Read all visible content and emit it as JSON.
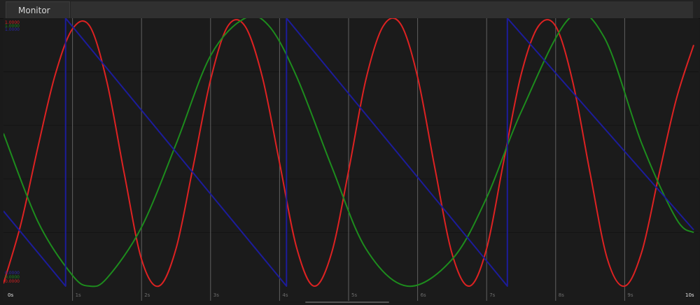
{
  "window": {
    "tab_label": "Monitor"
  },
  "colors": {
    "background": "#1b1b1b",
    "grid_minor": "#141414",
    "grid_major": "#606060",
    "red": "#dd2222",
    "green": "#1d8c1d",
    "blue": "#1c1c9a"
  },
  "chart_data": {
    "type": "line",
    "title": "",
    "xlabel": "",
    "ylabel": "",
    "xlim": [
      0,
      10
    ],
    "ylim": [
      0,
      1
    ],
    "grid": true,
    "x_ticks": [
      "0s",
      "1s",
      "2s",
      "3s",
      "4s",
      "5s",
      "6s",
      "7s",
      "8s",
      "9s",
      "10s"
    ],
    "legend": {
      "top": [
        {
          "text": "1.0000",
          "color": "#dd2222"
        },
        {
          "text": "1.0000",
          "color": "#1d8c1d"
        },
        {
          "text": "1.0000",
          "color": "#2a2ab0"
        }
      ],
      "bottom": [
        {
          "text": "0.0000",
          "color": "#2a2ab0"
        },
        {
          "text": "0.0000",
          "color": "#1d8c1d"
        },
        {
          "text": "0.0000",
          "color": "#dd2222"
        }
      ]
    },
    "series": [
      {
        "color": "#dd2222",
        "x": [
          0,
          0.25,
          0.5,
          0.75,
          1.0,
          1.25,
          1.5,
          1.75,
          2.0,
          2.25,
          2.5,
          2.75,
          3.0,
          3.25,
          3.5,
          3.75,
          4.0,
          4.25,
          4.5,
          4.75,
          5.0,
          5.25,
          5.5,
          5.75,
          6.0,
          6.25,
          6.5,
          6.75,
          7.0,
          7.25,
          7.5,
          7.75,
          8.0,
          8.25,
          8.5,
          8.75,
          9.0,
          9.25,
          9.5,
          9.75,
          10.0
        ],
        "y": [
          0.01,
          0.23,
          0.52,
          0.79,
          0.96,
          0.97,
          0.76,
          0.42,
          0.1,
          0.0,
          0.14,
          0.45,
          0.77,
          0.97,
          0.97,
          0.78,
          0.46,
          0.14,
          0.0,
          0.12,
          0.43,
          0.77,
          0.97,
          0.98,
          0.78,
          0.44,
          0.12,
          0.0,
          0.14,
          0.47,
          0.79,
          0.97,
          0.97,
          0.76,
          0.42,
          0.1,
          0.0,
          0.13,
          0.42,
          0.7,
          0.9
        ]
      },
      {
        "color": "#1d8c1d",
        "x": [
          0,
          0.5,
          1.0,
          1.25,
          1.5,
          2.0,
          2.5,
          3.0,
          3.5,
          3.85,
          4.25,
          4.75,
          5.25,
          5.85,
          6.5,
          7.0,
          7.5,
          8.2,
          8.7,
          9.25,
          9.75,
          10.0
        ],
        "y": [
          0.57,
          0.24,
          0.04,
          0.0,
          0.03,
          0.22,
          0.53,
          0.86,
          1.0,
          0.97,
          0.78,
          0.45,
          0.14,
          0.0,
          0.1,
          0.33,
          0.65,
          1.0,
          0.93,
          0.53,
          0.25,
          0.2
        ]
      },
      {
        "color": "#1c1c9a",
        "x": [
          0,
          0.9,
          0.9,
          4.1,
          4.1,
          7.3,
          7.3,
          10.0
        ],
        "y": [
          0.28,
          0.0,
          1.0,
          0.0,
          1.0,
          0.0,
          1.0,
          0.21
        ]
      }
    ]
  }
}
